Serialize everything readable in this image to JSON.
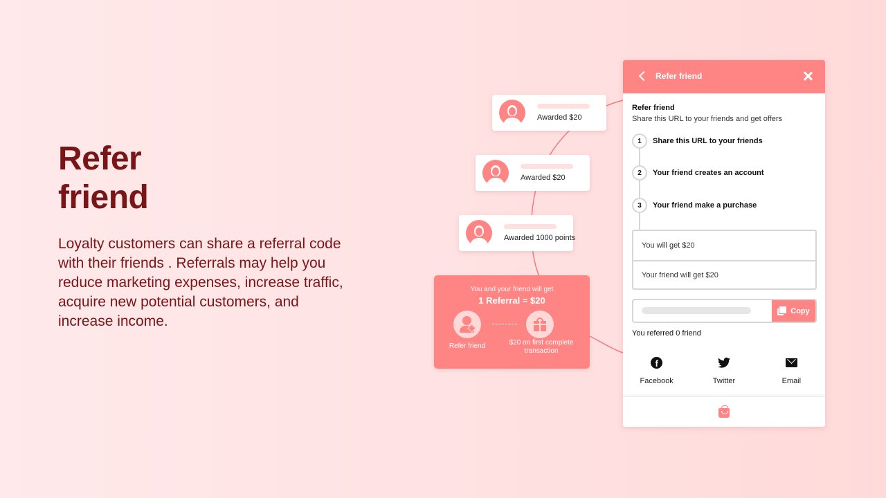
{
  "hero": {
    "title_line1": "Refer",
    "title_line2": "friend",
    "description": "Loyalty customers can share a referral code with their friends . Referrals may help you reduce marketing expenses, increase traffic, acquire new potential customers, and increase income."
  },
  "award_cards": [
    {
      "label": "Awarded $20",
      "avatar": "woman-avatar-icon"
    },
    {
      "label": "Awarded $20",
      "avatar": "bearded-man-avatar-icon"
    },
    {
      "label": "Awarded 1000 points",
      "avatar": "man-tie-avatar-icon"
    }
  ],
  "promo": {
    "subtitle": "You and your friend will get",
    "headline": "1 Referral = $20",
    "left_caption": "Refer friend",
    "right_caption": "$20 on first complete transaction"
  },
  "panel": {
    "header_title": "Refer friend",
    "section_title": "Refer friend",
    "section_desc": "Share this URL to your friends and get offers",
    "steps": [
      {
        "num": "1",
        "text": "Share this URL to your friends"
      },
      {
        "num": "2",
        "text": "Your friend creates an account"
      },
      {
        "num": "3",
        "text": "Your friend make a purchase"
      }
    ],
    "rewards": [
      "You will get $20",
      "Your friend will get $20"
    ],
    "copy_label": "Copy",
    "referred_text": "You referred 0 friend",
    "shares": [
      {
        "label": "Facebook",
        "icon": "facebook-icon"
      },
      {
        "label": "Twitter",
        "icon": "twitter-icon"
      },
      {
        "label": "Email",
        "icon": "email-icon"
      }
    ]
  },
  "colors": {
    "accent": "#ff8585",
    "title_text": "#7a1517",
    "background_start": "#ffe9ea",
    "background_end": "#ffdad9"
  }
}
